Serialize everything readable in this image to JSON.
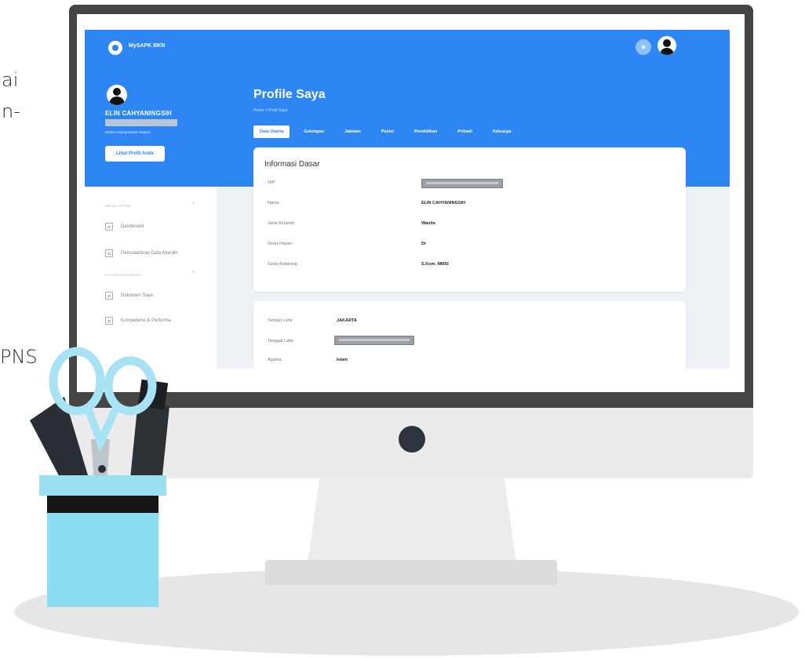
{
  "edge_text": {
    "line1": "ai",
    "line2": "n-",
    "line3": "PNS"
  },
  "app": {
    "name": "MySAPK BKN",
    "colors": {
      "primary": "#2e86f5",
      "bezel": "#454545",
      "background": "#eef1f6"
    }
  },
  "header": {
    "notification_icon": "bell-icon",
    "avatar_icon": "user-icon"
  },
  "sidebar": {
    "user_name": "ELIN CAHYANINGSIH",
    "user_subtitle": "Badan Kepegawaian Negara",
    "profile_button": "Lihat Profil Anda",
    "sections": [
      {
        "label": "MENU UTAMA",
        "items": [
          {
            "label": "Dashboard",
            "icon": "dashboard-icon"
          },
          {
            "label": "Pemutakhiran Data Mandiri",
            "icon": "list-icon"
          }
        ]
      },
      {
        "label": "LAYANAN LAINNYA",
        "items": [
          {
            "label": "Dokumen Saya",
            "icon": "document-icon"
          },
          {
            "label": "Kompetensi & Performa",
            "icon": "grid-icon"
          }
        ]
      }
    ]
  },
  "main": {
    "title": "Profile Saya",
    "breadcrumb": "Home > Profil Saya",
    "tabs": [
      "Data Utama",
      "Golongan",
      "Jabatan",
      "Posisi",
      "Pendidikan",
      "Pribadi",
      "Keluarga"
    ],
    "active_tab": "Data Utama",
    "card1": {
      "title": "Informasi Dasar",
      "rows": [
        {
          "label": "NIP",
          "value": ""
        },
        {
          "label": "Nama",
          "value": "ELIN CAHYANINGSIH"
        },
        {
          "label": "Jenis Kelamin",
          "value": "Wanita"
        },
        {
          "label": "Gelar Depan",
          "value": "Dr"
        },
        {
          "label": "Gelar Belakang",
          "value": "S.Kom, MMSI"
        }
      ]
    },
    "card2": {
      "rows": [
        {
          "label": "Tempat Lahir",
          "value": "JAKARTA"
        },
        {
          "label": "Tanggal Lahir",
          "value": ""
        },
        {
          "label": "Agama",
          "value": "Islam"
        }
      ]
    }
  }
}
